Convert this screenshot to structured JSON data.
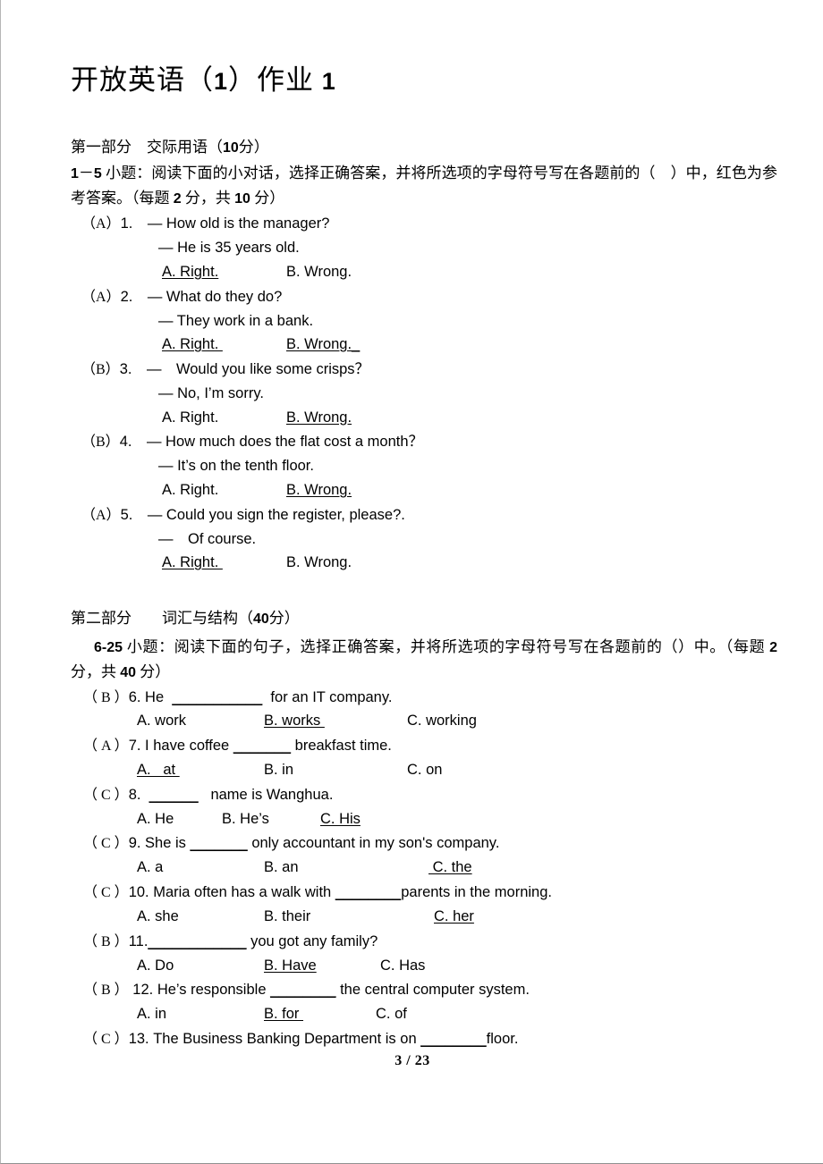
{
  "document": {
    "title": "开放英语（1）作业 1",
    "title_prefix": "开放英语（",
    "title_number": "1",
    "title_middle": "）作业 ",
    "title_suffix": "1",
    "footer": "3 / 23",
    "page_number": 3,
    "total_pages": 23
  },
  "part1": {
    "heading": "第一部分　交际用语（",
    "heading_points": "10",
    "heading_tail": "分）",
    "instruction_a": "1",
    "instruction_b": "－",
    "instruction_c": "5",
    "instruction_d": " 小题：阅读下面的小对话，选择正确答案，并将所选项的字母符号写在各题前的（　）中，红色为参考答案。（每题 ",
    "instruction_e": "2",
    "instruction_f": " 分，共 ",
    "instruction_g": "10",
    "instruction_h": " 分）",
    "questions": [
      {
        "answer": "（A）",
        "number": "1.",
        "prompt": "— How old is the manager?",
        "reply": "— He is 35 years old.",
        "option_a": "A. Right.",
        "option_b": "B. Wrong.",
        "correct": "A"
      },
      {
        "answer": "（A）",
        "number": "2.",
        "prompt": "— What do they do?",
        "reply": "— They work in a bank.",
        "option_a": "A. Right. ",
        "option_b": "B. Wrong._",
        "correct": "A"
      },
      {
        "answer": "（B）",
        "number": "3.",
        "prompt": "—　Would you like some crisps？",
        "reply": "— No, I’m sorry.",
        "option_a": "A. Right.",
        "option_b": "B. Wrong.",
        "correct": "B"
      },
      {
        "answer": "（B）",
        "number": "4.",
        "prompt": "— How much does the flat cost a month？",
        "reply": "— It’s on the tenth floor.",
        "option_a": "A. Right.",
        "option_b": "B. Wrong.",
        "correct": "B"
      },
      {
        "answer": "（A）",
        "number": "5.",
        "prompt": "— Could you sign the register, please?.",
        "reply": "—　Of course.",
        "option_a": "A. Right. ",
        "option_b": "B. Wrong.",
        "correct": "A"
      }
    ]
  },
  "part2": {
    "heading": "第二部分　　词汇与结构（",
    "heading_points": "40",
    "heading_tail": "分）",
    "instruction_a": "6-25",
    "instruction_b": " 小题：阅读下面的句子，选择正确答案，并将所选项的字母符号写在各题前的（）中。（每题 ",
    "instruction_c": "2",
    "instruction_d": " 分，共 ",
    "instruction_e": "40",
    "instruction_f": " 分）",
    "questions": [
      {
        "answer": "（ B ）",
        "number": "6.",
        "text_before": "He  ",
        "blank": "___________",
        "text_after": "  for an IT company.",
        "option_a": "A. work",
        "option_b": "B. works ",
        "option_c": "C. working",
        "correct": "B"
      },
      {
        "answer": "（ A ）",
        "number": "7.",
        "text_before": "I have coffee ",
        "blank": "_______",
        "text_after": " breakfast time.",
        "option_a": "A.   at ",
        "option_b": "B. in",
        "option_c": "C. on",
        "correct": "A"
      },
      {
        "answer": "（ C ）",
        "number": "8.",
        "text_before": "  ",
        "blank": "______",
        "text_after": "   name is Wanghua.",
        "option_a": "A. He",
        "option_b": "B. He’s",
        "option_c": "C. His",
        "correct": "C"
      },
      {
        "answer": "（ C ）",
        "number": "9.",
        "text_before": "She is ",
        "blank": "_______",
        "text_after": " only accountant in my son's company.",
        "option_a": "A. a",
        "option_b": "B. an",
        "option_c": " C. the",
        "correct": "C"
      },
      {
        "answer": "（ C ）",
        "number": "10.",
        "text_before": "Maria often has a walk with ",
        "blank": "________",
        "text_after": "parents in the morning.",
        "option_a": "A. she",
        "option_b": "B. their",
        "option_c": "C. her",
        "correct": "C"
      },
      {
        "answer": "（ B ）",
        "number": "11.",
        "text_before": "",
        "blank": "____________",
        "text_after": " you got any family?",
        "option_a": "A. Do",
        "option_b": "B. Have",
        "option_c": "C. Has",
        "correct": "B"
      },
      {
        "answer": "（ B ）",
        "number": " 12.",
        "text_before": "He’s responsible ",
        "blank": "________",
        "text_after": " the central computer system.",
        "option_a": "A. in",
        "option_b": "B. for ",
        "option_c": "C. of",
        "correct": "B"
      },
      {
        "answer": "（ C ）",
        "number": "13.",
        "text_before": "The Business Banking Department is on ",
        "blank": "________",
        "text_after": "floor.",
        "option_a": "",
        "option_b": "",
        "option_c": "",
        "correct": "C"
      }
    ]
  }
}
